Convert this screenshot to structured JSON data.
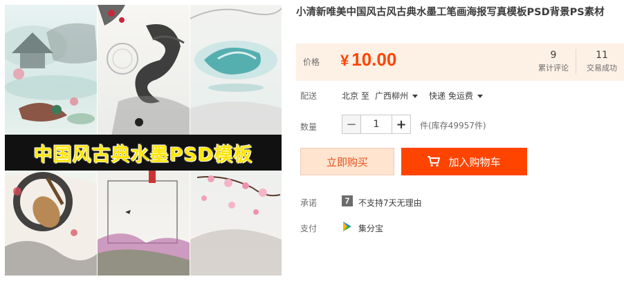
{
  "product": {
    "title": "小清新唯美中国风古风古典水墨工笔画海报写真模板PSD背景PS素材",
    "banner_text": "中国风古典水墨PSD模板"
  },
  "price": {
    "label": "价格",
    "currency": "¥",
    "amount": "10.00",
    "reviews_count": "9",
    "reviews_label": "累计评论",
    "deals_count": "11",
    "deals_label": "交易成功"
  },
  "shipping": {
    "label": "配送",
    "from": "北京 至",
    "to": "广西柳州",
    "method": "快递 免运费"
  },
  "quantity": {
    "label": "数量",
    "minus": "−",
    "value": "1",
    "plus": "+",
    "stock_text": "件(库存49957件)"
  },
  "actions": {
    "buy_now": "立即购买",
    "add_to_cart": "加入购物车"
  },
  "promise": {
    "label": "承诺",
    "icon_glyph": "7",
    "text": "不支持7天无理由"
  },
  "payment": {
    "label": "支付",
    "text": "集分宝"
  },
  "colors": {
    "accent": "#ff4400",
    "price_bg": "#fdf0e5",
    "buy_bg": "#ffe4d0",
    "banner_text": "#ffe500"
  }
}
